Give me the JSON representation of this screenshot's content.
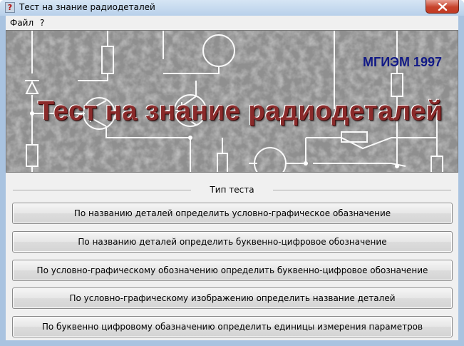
{
  "window": {
    "title": "Тест на знание радиодеталей",
    "icon": "question-icon",
    "icon_glyph": "?"
  },
  "menu": [
    "Файл",
    "?"
  ],
  "banner": {
    "title": "Тест на знание радиодеталей",
    "org": "МГИЭМ 1997"
  },
  "group": {
    "label": "Тип теста"
  },
  "buttons": [
    "По названию деталей определить условно-графическое обазначение",
    "По названию деталей определить буквенно-цифровое обозначение",
    "По условно-графическому обозначению определить буквенно-цифровое обозначение",
    "По условно-графическому изображению определить название деталей",
    "По буквенно цифровому обазначению определить единицы измерения параметров"
  ],
  "colors": {
    "title_close": "#c7432c",
    "banner_text": "#8a2a2a",
    "org_text": "#121a86"
  }
}
